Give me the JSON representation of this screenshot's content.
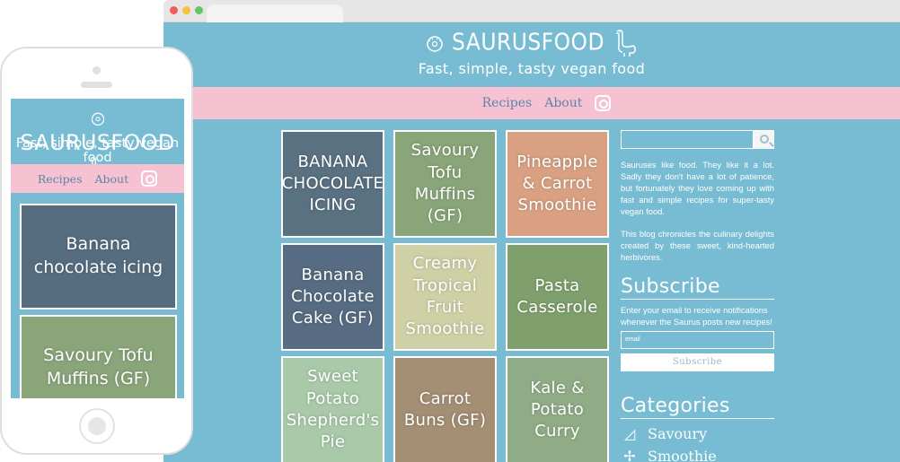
{
  "site": {
    "title": "SAURUSFOOD",
    "tagline": "Fast, simple, tasty vegan food",
    "nav": {
      "recipes": "Recipes",
      "about": "About"
    }
  },
  "colors": {
    "background": "#77bcd2",
    "nav_bar": "#f6c2d2",
    "nav_text": "#5b86a8",
    "text": "#ffffff"
  },
  "desktop": {
    "tiles": [
      {
        "label": "BANANA CHOCOLATE ICING",
        "bg": "#5a7182"
      },
      {
        "label": "Savoury Tofu Muffins (GF)",
        "bg": "#8aa57a"
      },
      {
        "label": "Pineapple & Carrot Smoothie",
        "bg": "#d9a182"
      },
      {
        "label": "Banana Chocolate Cake (GF)",
        "bg": "#576c82"
      },
      {
        "label": "Creamy Tropical Fruit Smoothie",
        "bg": "#cfd0a6"
      },
      {
        "label": "Pasta Casserole",
        "bg": "#7f9f6c"
      },
      {
        "label": "Sweet Potato Shepherd's Pie",
        "bg": "#a9c9a9"
      },
      {
        "label": "Carrot Buns (GF)",
        "bg": "#a48e74"
      },
      {
        "label": "Kale & Potato Curry",
        "bg": "#8fac86"
      }
    ],
    "sidebar": {
      "about_1": "Sauruses like food. They like it a lot. Sadly they don't have a lot of patience, but fortunately they love coming up with fast and simple recipes for super-tasty vegan food.",
      "about_2": "This blog chronicles the culinary delights created by these sweet, kind-hearted herbivores.",
      "subscribe_heading": "Subscribe",
      "subscribe_text": "Enter your email to receive notifications whenever the Saurus posts new recipes!",
      "email_placeholder": "email",
      "subscribe_button": "Subscribe",
      "categories_heading": "Categories",
      "categories": [
        {
          "label": "Savoury",
          "icon": "pizza-slice-icon"
        },
        {
          "label": "Smoothie",
          "icon": "fruit-icon"
        }
      ]
    }
  },
  "mobile": {
    "cards": [
      {
        "label": "Banana chocolate icing",
        "bg": "#566d80"
      },
      {
        "label": "Savoury Tofu Muffins (GF)",
        "bg": "#8aa57a"
      }
    ]
  }
}
